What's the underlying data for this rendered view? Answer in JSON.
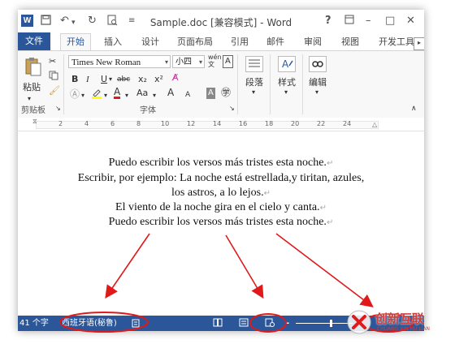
{
  "titlebar": {
    "app_icon": "W",
    "title": "Sample.doc [兼容模式] - Word",
    "help": "?",
    "minimize": "–",
    "maximize": "□",
    "close": "✕"
  },
  "tabs": {
    "file": "文件",
    "items": [
      "开始",
      "插入",
      "设计",
      "页面布局",
      "引用",
      "邮件",
      "审阅",
      "视图",
      "开发工具"
    ]
  },
  "ribbon": {
    "clipboard": {
      "paste": "粘贴",
      "group": "剪贴板"
    },
    "font": {
      "name": "Times New Roman",
      "size": "小四",
      "bold": "B",
      "italic": "I",
      "underline": "U",
      "strike": "abc",
      "sub": "x₂",
      "sup": "x²",
      "grow": "A",
      "shrink": "A",
      "aa": "Aa",
      "group": "字体"
    },
    "paragraph": {
      "label": "段落"
    },
    "styles": {
      "label": "样式"
    },
    "editing": {
      "label": "编辑"
    }
  },
  "ruler": {
    "numbers": [
      "2",
      "4",
      "6",
      "8",
      "10",
      "12",
      "14",
      "16",
      "18",
      "20",
      "22",
      "24"
    ]
  },
  "document": {
    "lines": [
      "Puedo escribir los versos más tristes esta noche.",
      "Escribir, por ejemplo: La noche está estrellada,y tiritan, azules,",
      "los astros, a lo lejos.",
      "El viento de la noche gira en el cielo y canta.",
      "Puedo escribir los versos más tristes esta noche."
    ]
  },
  "status": {
    "word_count": "41 个字",
    "language": "西班牙语(秘鲁)",
    "zoom_minus": "-"
  },
  "watermark": {
    "name": "创新互联",
    "sub": "CHUANG XIN HU LIAN"
  },
  "colors": {
    "word_blue": "#2b579a",
    "annotation_red": "#e0191b"
  }
}
